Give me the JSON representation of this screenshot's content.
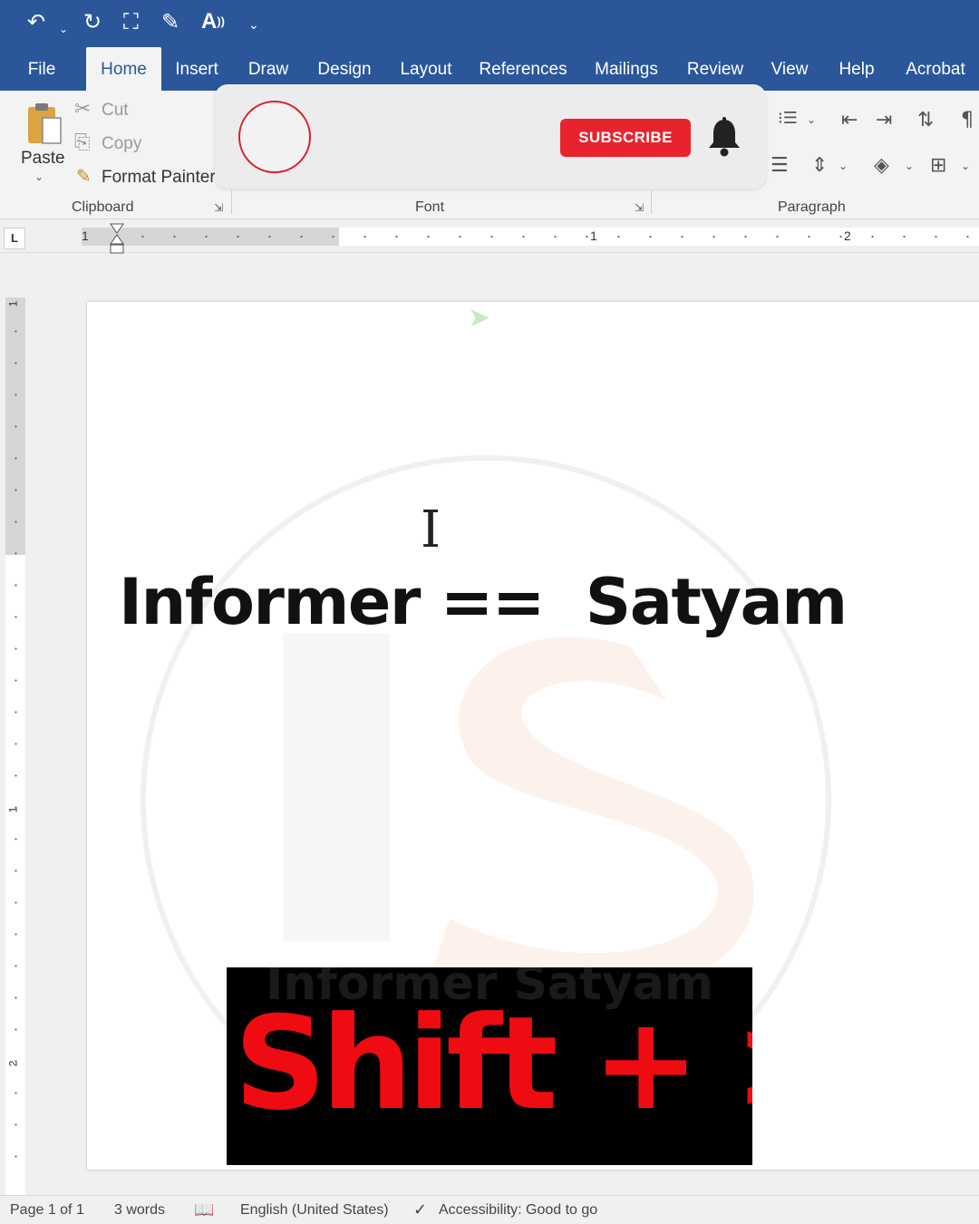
{
  "quick_access": {
    "undo_icon": "undo-icon",
    "redo_icon": "redo-icon",
    "read_aloud_label": "A",
    "customize_icon": "customize-qat-icon"
  },
  "tabs": [
    {
      "label": "File"
    },
    {
      "label": "Home",
      "active": true
    },
    {
      "label": "Insert"
    },
    {
      "label": "Draw"
    },
    {
      "label": "Design"
    },
    {
      "label": "Layout"
    },
    {
      "label": "References"
    },
    {
      "label": "Mailings"
    },
    {
      "label": "Review"
    },
    {
      "label": "View"
    },
    {
      "label": "Help"
    },
    {
      "label": "Acrobat"
    }
  ],
  "clipboard": {
    "paste_label": "Paste",
    "cut_label": "Cut",
    "copy_label": "Copy",
    "format_painter_label": "Format Painter",
    "group_label": "Clipboard"
  },
  "font": {
    "group_label": "Font"
  },
  "paragraph": {
    "group_label": "Paragraph"
  },
  "overlay": {
    "subscribe_label": "SUBSCRIBE",
    "accent_color": "#e8232d"
  },
  "ruler": {
    "left_tick": "1",
    "mid_tick": "1",
    "right_tick": "2",
    "tab_selector": "L"
  },
  "vertical_ruler": {
    "top_label": "1",
    "mid_label": "1",
    "bottom_label": "2"
  },
  "document": {
    "heading": "Informer ==  Satyam",
    "watermark_text": "Informer Satyam"
  },
  "shortcut_caption": {
    "text": "Shift + >",
    "color": "#ee0c12"
  },
  "status_bar": {
    "page": "Page 1 of 1",
    "words": "3 words",
    "language": "English (United States)",
    "accessibility": "Accessibility: Good to go"
  },
  "colors": {
    "title_bar": "#2b579a",
    "ribbon": "#f3f3f3"
  }
}
